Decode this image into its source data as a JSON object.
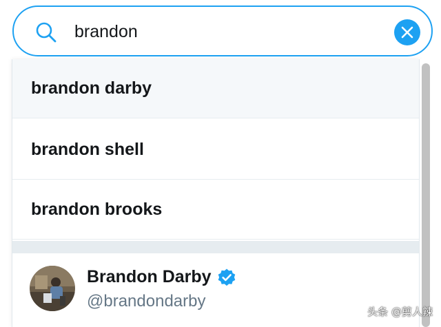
{
  "search": {
    "value": "brandon",
    "icon": "search-icon",
    "clear_icon": "close-icon"
  },
  "suggestions": [
    {
      "label": "brandon darby"
    },
    {
      "label": "brandon shell"
    },
    {
      "label": "brandon brooks"
    }
  ],
  "user_result": {
    "name": "Brandon Darby",
    "handle": "@brandondarby",
    "verified_icon": "verified-badge-icon"
  },
  "watermark": "头条 @剪人辣",
  "colors": {
    "accent": "#1da1f2",
    "text_primary": "#14171a",
    "text_secondary": "#657786",
    "active_row_bg": "#f5f8fa",
    "divider": "#e6ecf0"
  }
}
